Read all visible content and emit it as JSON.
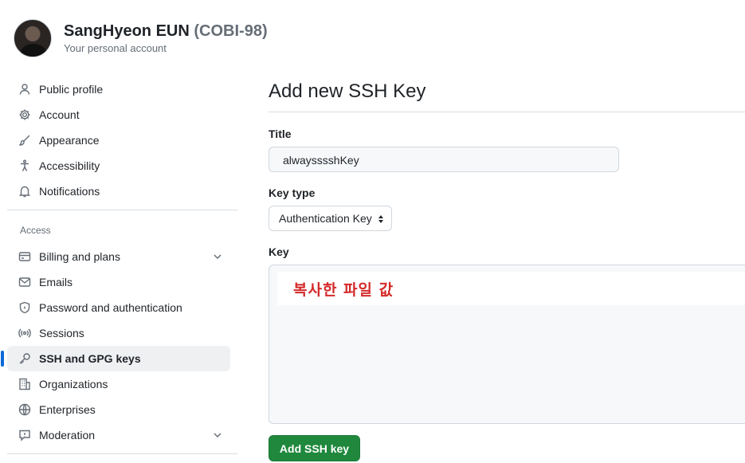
{
  "account": {
    "name": "SangHyeon EUN",
    "login": "(COBI-98)",
    "subtitle": "Your personal account"
  },
  "sidebar": {
    "items": [
      {
        "label": "Public profile",
        "icon": "person-icon"
      },
      {
        "label": "Account",
        "icon": "gear-icon"
      },
      {
        "label": "Appearance",
        "icon": "paintbrush-icon"
      },
      {
        "label": "Accessibility",
        "icon": "accessibility-icon"
      },
      {
        "label": "Notifications",
        "icon": "bell-icon"
      }
    ],
    "access_label": "Access",
    "access_items": [
      {
        "label": "Billing and plans",
        "icon": "credit-card-icon",
        "expandable": true
      },
      {
        "label": "Emails",
        "icon": "mail-icon"
      },
      {
        "label": "Password and authentication",
        "icon": "shield-lock-icon"
      },
      {
        "label": "Sessions",
        "icon": "broadcast-icon"
      },
      {
        "label": "SSH and GPG keys",
        "icon": "key-icon",
        "active": true
      },
      {
        "label": "Organizations",
        "icon": "organization-icon"
      },
      {
        "label": "Enterprises",
        "icon": "globe-icon"
      },
      {
        "label": "Moderation",
        "icon": "report-icon",
        "expandable": true
      }
    ]
  },
  "main": {
    "page_title": "Add new SSH Key",
    "title_label": "Title",
    "title_value": "alwaysssshKey",
    "key_type_label": "Key type",
    "key_type_value": "Authentication Key",
    "key_label": "Key",
    "key_annotation": "복사한 파일 값",
    "submit_label": "Add SSH key"
  },
  "colors": {
    "accent": "#0969da",
    "primary_button": "#1f883d",
    "annotation": "#d42a2a"
  }
}
